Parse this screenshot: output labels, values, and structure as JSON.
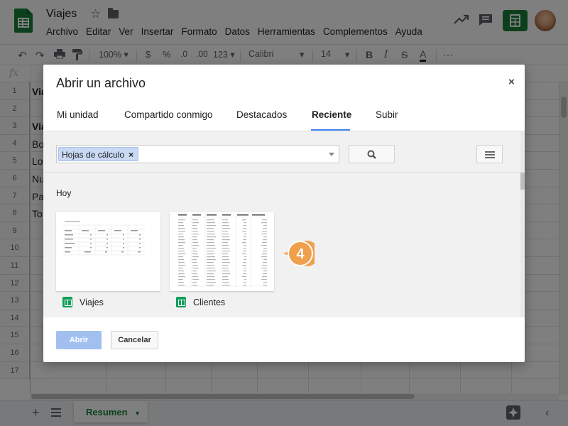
{
  "header": {
    "title": "Viajes",
    "menu": [
      "Archivo",
      "Editar",
      "Ver",
      "Insertar",
      "Formato",
      "Datos",
      "Herramientas",
      "Complementos",
      "Ayuda"
    ]
  },
  "toolbar": {
    "zoom": "100%",
    "currency": "$",
    "percent": "%",
    "decimal_decrease": ".0",
    "decimal_increase": ".00",
    "more_formats": "123",
    "font": "Calibri",
    "font_size": "14",
    "bold": "B",
    "italic": "I",
    "strikethrough": "S",
    "text_color": "A",
    "more": "⋯"
  },
  "formula_bar": {
    "fx": "fx"
  },
  "grid": {
    "rows": [
      "1",
      "2",
      "3",
      "4",
      "5",
      "6",
      "7",
      "8",
      "9",
      "10",
      "11",
      "12",
      "13",
      "14",
      "15",
      "16",
      "17"
    ],
    "cells": [
      "Via",
      "",
      "Via",
      "Bo",
      "Lo",
      "Nu",
      "Pa",
      "To"
    ]
  },
  "bottom": {
    "sheet_tab": "Resumen"
  },
  "dialog": {
    "title": "Abrir un archivo",
    "close": "×",
    "tabs": [
      "Mi unidad",
      "Compartido conmigo",
      "Destacados",
      "Reciente",
      "Subir"
    ],
    "active_tab": "Reciente",
    "filter_chip": "Hojas de cálculo",
    "section": "Hoy",
    "files": [
      {
        "name": "Viajes"
      },
      {
        "name": "Clientes"
      }
    ],
    "open_button": "Abrir",
    "cancel_button": "Cancelar"
  },
  "callout": {
    "number": "4"
  },
  "colors": {
    "sheets_green": "#188038",
    "accent_blue": "#4285f4",
    "callout_orange": "#f0a04b",
    "chip_blue": "#c9d9f3",
    "disabled_button": "#a1c0f0"
  }
}
